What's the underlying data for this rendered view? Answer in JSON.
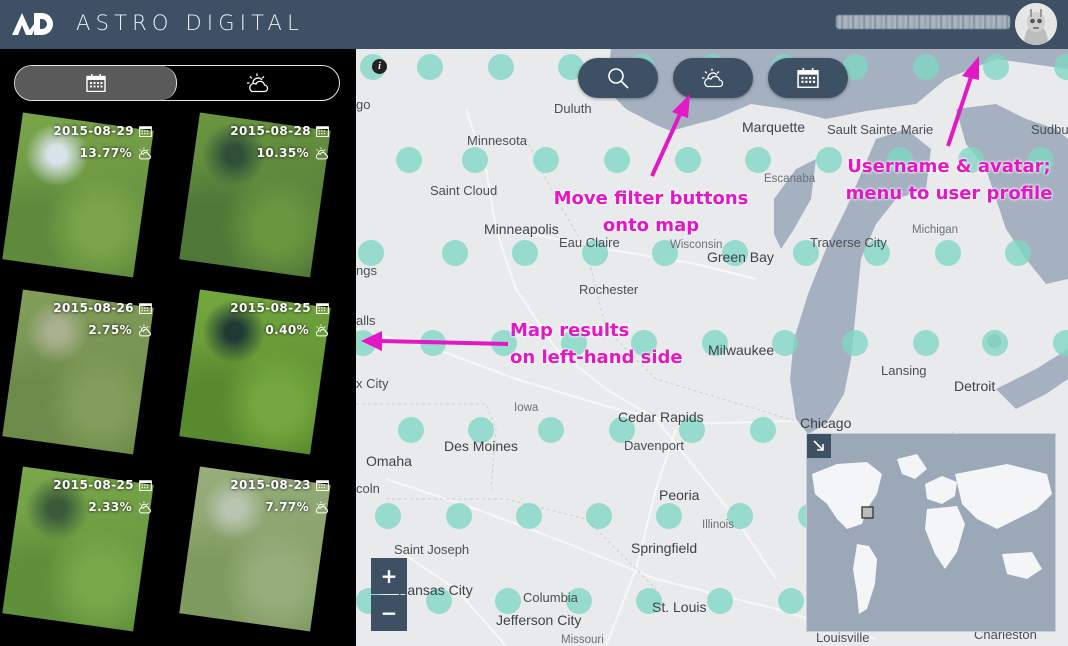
{
  "header": {
    "logo_text": "AD",
    "brand": "ASTRO DIGITAL",
    "username": "",
    "avatar_icon": "robot-avatar-icon"
  },
  "sidebar": {
    "toggle": {
      "left_icon": "calendar-icon",
      "right_icon": "sun-cloud-icon",
      "active": "calendar"
    },
    "results": [
      {
        "date": "2015-08-29",
        "cloud": "13.77%"
      },
      {
        "date": "2015-08-28",
        "cloud": "10.35%"
      },
      {
        "date": "2015-08-26",
        "cloud": "2.75%"
      },
      {
        "date": "2015-08-25",
        "cloud": "0.40%"
      },
      {
        "date": "2015-08-25",
        "cloud": "2.33%"
      },
      {
        "date": "2015-08-23",
        "cloud": "7.77%"
      }
    ]
  },
  "map": {
    "filter_buttons": [
      "search-icon",
      "sun-cloud-icon",
      "calendar-icon"
    ],
    "zoom_in": "+",
    "zoom_out": "−",
    "info": "i",
    "cities": [
      "Duluth",
      "Marquette",
      "Sault Sainte Marie",
      "Sudbury",
      "Minnesota",
      "Escanaba",
      "Saint Cloud",
      "Minneapolis",
      "Eau Claire",
      "Wisconsin",
      "Green Bay",
      "Traverse City",
      "Michigan",
      "Rochester",
      "Milwaukee",
      "Lansing",
      "Detroit",
      "Iowa",
      "Cedar Rapids",
      "Davenport",
      "Des Moines",
      "Chicago",
      "Omaha",
      "Peoria",
      "Illinois",
      "Springfield",
      "Saint Joseph",
      "Kansas City",
      "Columbia",
      "Jefferson City",
      "St. Louis",
      "Missouri",
      "Louisville",
      "Charleston"
    ],
    "edge_labels": [
      "go",
      "ngs",
      "alls",
      "x City",
      "coln"
    ]
  },
  "annotations": {
    "filters": [
      "Move filter buttons",
      "onto map"
    ],
    "results": [
      "Map results",
      "on left-hand side"
    ],
    "user": [
      "Username & avatar;",
      "menu to user profile"
    ]
  },
  "colors": {
    "header": "#3d5064",
    "accent_dots": "#7fd6c4",
    "annotation": "#e218c6",
    "water": "#a5b1c0"
  }
}
